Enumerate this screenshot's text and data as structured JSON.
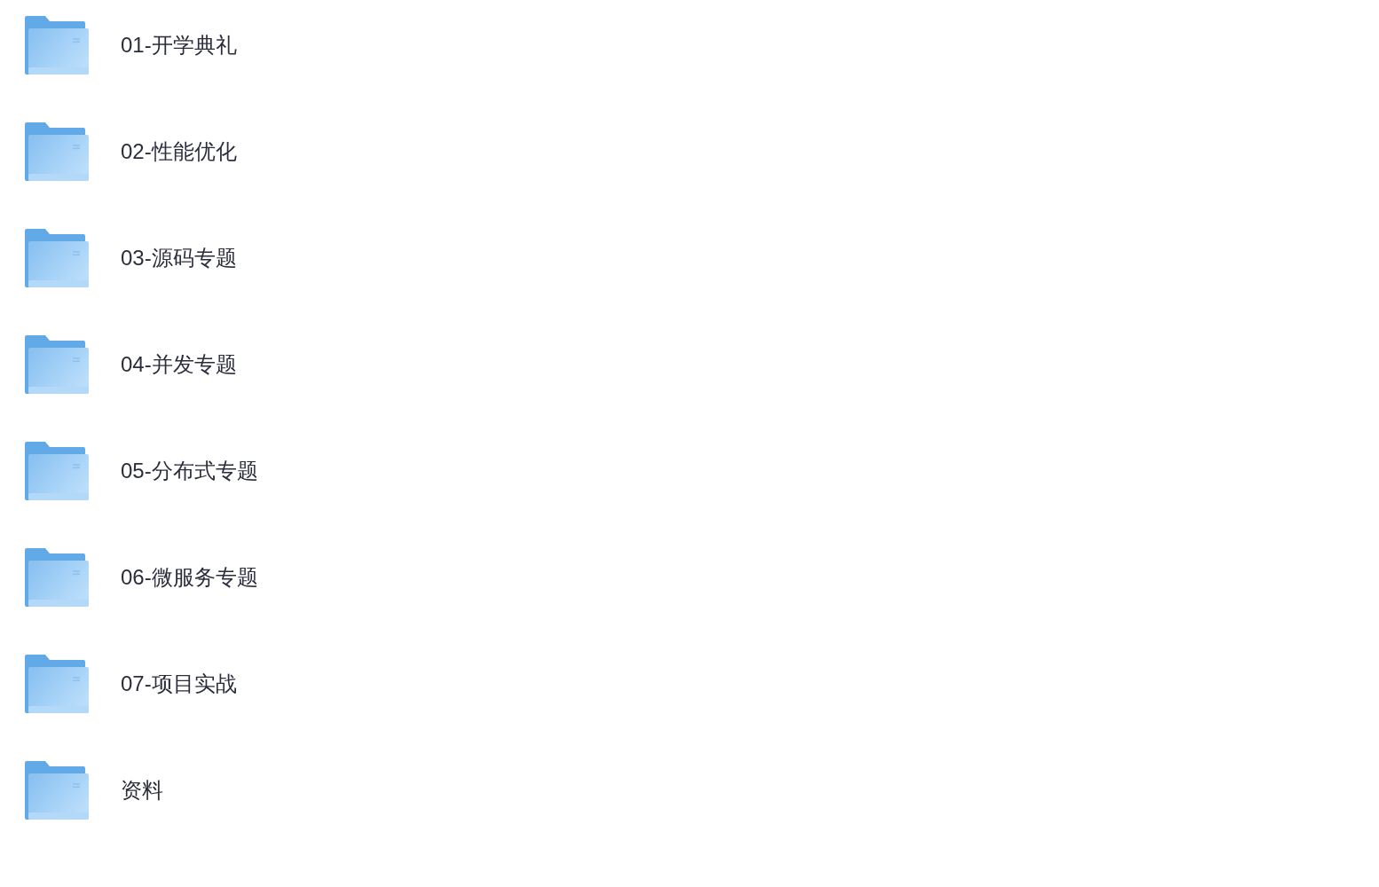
{
  "folders": [
    {
      "name": "01-开学典礼"
    },
    {
      "name": "02-性能优化"
    },
    {
      "name": "03-源码专题"
    },
    {
      "name": "04-并发专题"
    },
    {
      "name": "05-分布式专题"
    },
    {
      "name": "06-微服务专题"
    },
    {
      "name": "07-项目实战"
    },
    {
      "name": "资料"
    }
  ]
}
